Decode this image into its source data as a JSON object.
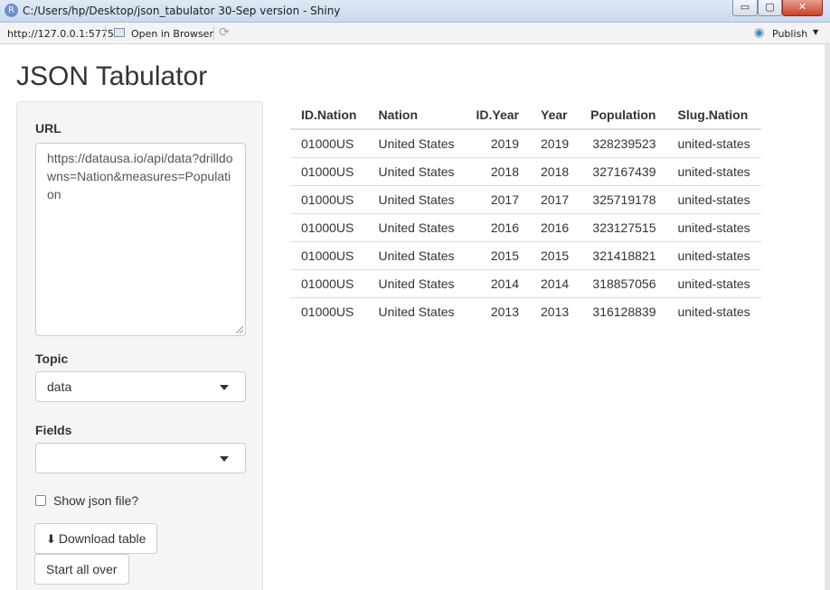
{
  "window": {
    "title": "C:/Users/hp/Desktop/json_tabulator 30-Sep version - Shiny",
    "app_icon": "R",
    "controls": {
      "minimize": "▭",
      "maximize": "▢",
      "close": "✕"
    }
  },
  "toolbar": {
    "url": "http://127.0.0.1:5775",
    "open_in_browser": "Open in Browser",
    "publish": "Publish",
    "icons": [
      "browser-icon",
      "refresh-icon",
      "publish-icon",
      "caret-down-icon"
    ]
  },
  "app": {
    "title": "JSON Tabulator",
    "sidebar": {
      "url_label": "URL",
      "url_value": "https://datausa.io/api/data?drilldowns=Nation&measures=Population",
      "topic_label": "Topic",
      "topic_value": "data",
      "fields_label": "Fields",
      "fields_value": "",
      "show_json_label": "Show json file?",
      "show_json_checked": false,
      "download_label": "Download table",
      "start_over_label": "Start all over"
    },
    "table": {
      "columns": [
        "ID.Nation",
        "Nation",
        "ID.Year",
        "Year",
        "Population",
        "Slug.Nation"
      ],
      "rows": [
        [
          "01000US",
          "United States",
          "2019",
          "2019",
          "328239523",
          "united-states"
        ],
        [
          "01000US",
          "United States",
          "2018",
          "2018",
          "327167439",
          "united-states"
        ],
        [
          "01000US",
          "United States",
          "2017",
          "2017",
          "325719178",
          "united-states"
        ],
        [
          "01000US",
          "United States",
          "2016",
          "2016",
          "323127515",
          "united-states"
        ],
        [
          "01000US",
          "United States",
          "2015",
          "2015",
          "321418821",
          "united-states"
        ],
        [
          "01000US",
          "United States",
          "2014",
          "2014",
          "318857056",
          "united-states"
        ],
        [
          "01000US",
          "United States",
          "2013",
          "2013",
          "316128839",
          "united-states"
        ]
      ]
    }
  }
}
